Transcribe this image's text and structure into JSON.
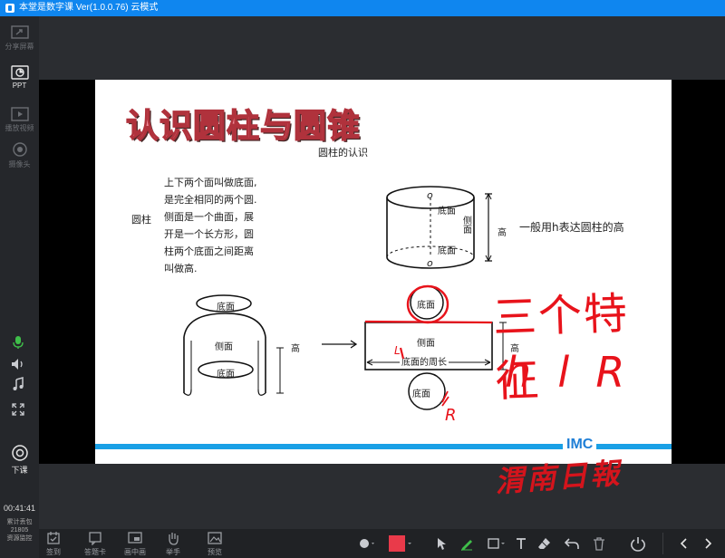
{
  "window": {
    "title": "本堂是数字课 Ver(1.0.0.76)  云模式"
  },
  "sidebar": {
    "items": [
      {
        "label": "分享屏幕"
      },
      {
        "label": "PPT"
      },
      {
        "label": "播放视频"
      },
      {
        "label": "摄像头"
      }
    ],
    "end_class_label": "下课",
    "timer": "00:41:41",
    "stats": [
      "累计丢包",
      "21805",
      "资源监控"
    ]
  },
  "slide": {
    "title": "认识圆柱与圆锥",
    "subtitle": "圆柱的认识",
    "term": "圆柱",
    "description": [
      "上下两个面叫做底面,",
      "是完全相同的两个圆.",
      "侧面是一个曲面，展",
      "开是一个长方形，圆",
      "柱两个底面之间距离",
      "叫做高."
    ],
    "height_note": "一般用h表达圆柱的高",
    "labels": {
      "base": "底面",
      "side": "侧面",
      "height": "高",
      "circumference": "底面的周长",
      "o": "o"
    },
    "handwriting": {
      "features": "三个特征",
      "letters": "h  l  R",
      "r_mark": "R",
      "l_mark": "L"
    },
    "watermark": {
      "brand": "IMC",
      "name": "渭南日報"
    },
    "colors": {
      "pen": "#e8131b",
      "bar": "#1aa0e6"
    }
  },
  "toolbar": {
    "items": [
      {
        "label": "签到"
      },
      {
        "label": "答题卡"
      },
      {
        "label": "画中画"
      },
      {
        "label": "举手"
      },
      {
        "label": "预览"
      }
    ],
    "pen_color": "#e93a4a"
  }
}
